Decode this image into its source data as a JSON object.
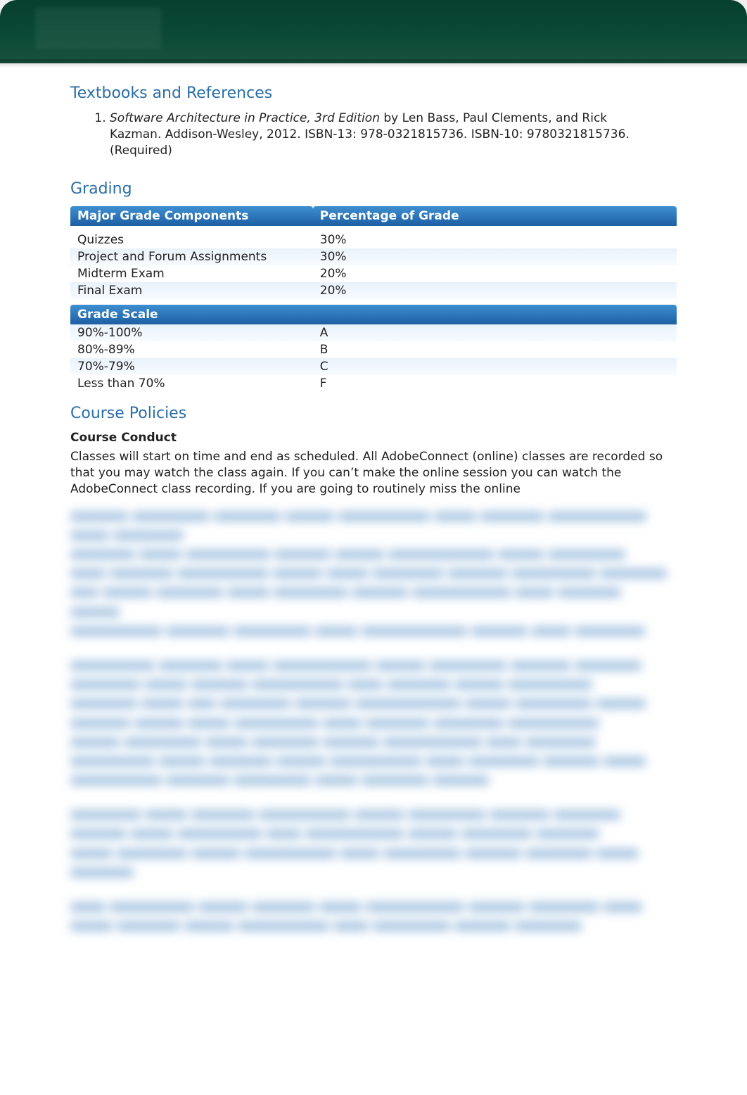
{
  "sections": {
    "textbooks_heading": "Textbooks and References",
    "grading_heading": "Grading",
    "policies_heading": "Course Policies"
  },
  "textbooks": [
    {
      "title": "Software Architecture in Practice, 3rd Edition",
      "rest": " by Len Bass, Paul Clements, and Rick Kazman. Addison-Wesley, 2012. ISBN-13: 978-0321815736. ISBN-10: 9780321815736. (Required)"
    }
  ],
  "grading": {
    "cols": [
      "Major Grade Components",
      "Percentage of Grade"
    ],
    "rows": [
      {
        "label": "Quizzes",
        "pct": "30%"
      },
      {
        "label": "Project and Forum Assignments",
        "pct": "30%"
      },
      {
        "label": "Midterm Exam",
        "pct": "20%"
      },
      {
        "label": "Final Exam",
        "pct": "20%"
      }
    ]
  },
  "grade_scale": {
    "header": "Grade Scale",
    "rows": [
      {
        "range": "90%-100%",
        "letter": "A"
      },
      {
        "range": "80%-89%",
        "letter": "B"
      },
      {
        "range": "70%-79%",
        "letter": "C"
      },
      {
        "range": "Less than 70%",
        "letter": "F"
      }
    ]
  },
  "policies": {
    "conduct_label": "Course Conduct",
    "conduct_para": "Classes will start on time and end as scheduled. All AdobeConnect (online) classes are recorded so that you may watch the class again. If you can’t make the online session you can watch the AdobeConnect class recording. If you are going to routinely miss the online"
  }
}
